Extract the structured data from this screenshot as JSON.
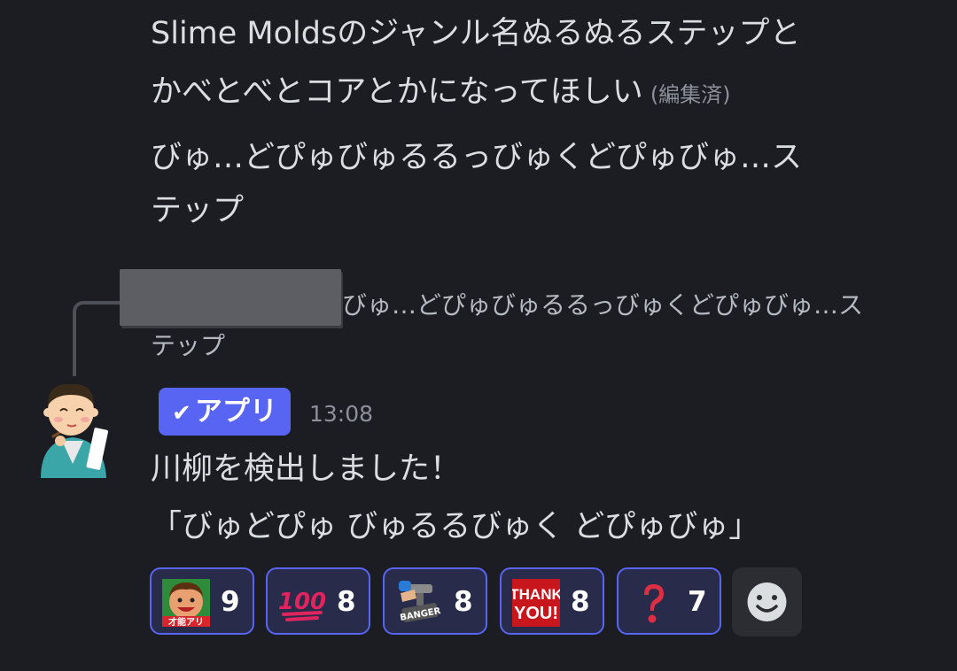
{
  "previous_messages": {
    "line1": "Slime Moldsのジャンル名ぬるぬるステップと",
    "line2": "かべとべとコアとかになってほしい",
    "edited": "(編集済)",
    "line3": "びゅ…どぴゅびゅるるっびゅくどぴゅびゅ…ス",
    "line4": "テップ"
  },
  "reply": {
    "line1": "びゅ…どぴゅびゅるるっびゅくどぴゅびゅ…ス",
    "line2": "テップ"
  },
  "message": {
    "badge_label": "アプリ",
    "timestamp": "13:08",
    "line1": "川柳を検出しました！",
    "line2": "「びゅどぴゅ びゅるるびゅく どぴゅびゅ」"
  },
  "reactions": [
    {
      "icon": "talent-app-face-emoji",
      "count": "9",
      "badge_text": "才能アリ"
    },
    {
      "icon": "hundred-points-emoji",
      "count": "8",
      "badge_text": "100"
    },
    {
      "icon": "banger-stamp-emoji",
      "count": "8",
      "badge_text": "BANGER"
    },
    {
      "icon": "thank-you-emoji",
      "count": "8",
      "badge_text_1": "THANK",
      "badge_text_2": "YOU!"
    },
    {
      "icon": "question-mark-emoji",
      "count": "7"
    }
  ],
  "add_reaction": {
    "icon": "smiley-icon"
  },
  "colors": {
    "background": "#1c1d22",
    "accent": "#5865f2",
    "reaction_bg": "#282b4a",
    "text": "#dbdee1",
    "muted": "#8c909a"
  }
}
